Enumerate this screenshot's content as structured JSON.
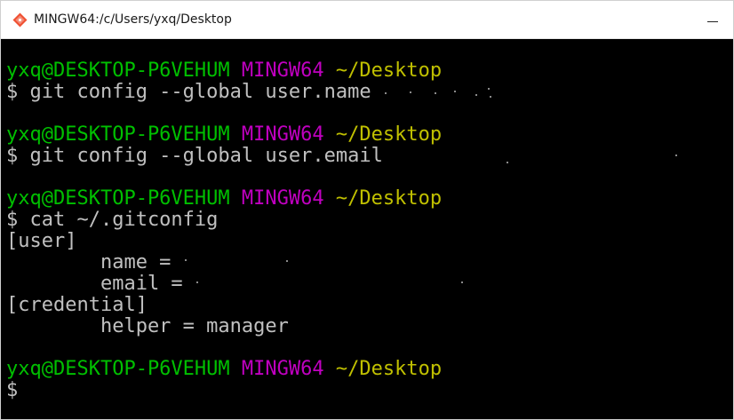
{
  "window": {
    "title": "MINGW64:/c/Users/yxq/Desktop",
    "app_icon": "git-diamond-icon",
    "minimize_glyph": "—"
  },
  "colors": {
    "user_host": "#00c000",
    "msystem": "#c000c0",
    "path": "#c0c000",
    "text": "#c0c0c0",
    "background": "#000000"
  },
  "terminal": {
    "prompts": [
      {
        "user_host": "yxq@DESKTOP-P6VEHUM",
        "msystem": "MINGW64",
        "path": "~/Desktop"
      },
      {
        "user_host": "yxq@DESKTOP-P6VEHUM",
        "msystem": "MINGW64",
        "path": "~/Desktop"
      },
      {
        "user_host": "yxq@DESKTOP-P6VEHUM",
        "msystem": "MINGW64",
        "path": "~/Desktop"
      },
      {
        "user_host": "yxq@DESKTOP-P6VEHUM",
        "msystem": "MINGW64",
        "path": "~/Desktop"
      }
    ],
    "commands": [
      "$ git config --global user.name",
      "$ git config --global user.email",
      "$ cat ~/.gitconfig",
      "$"
    ],
    "output": [
      "[user]",
      "        name =",
      "        email =",
      "[credential]",
      "        helper = manager"
    ]
  }
}
